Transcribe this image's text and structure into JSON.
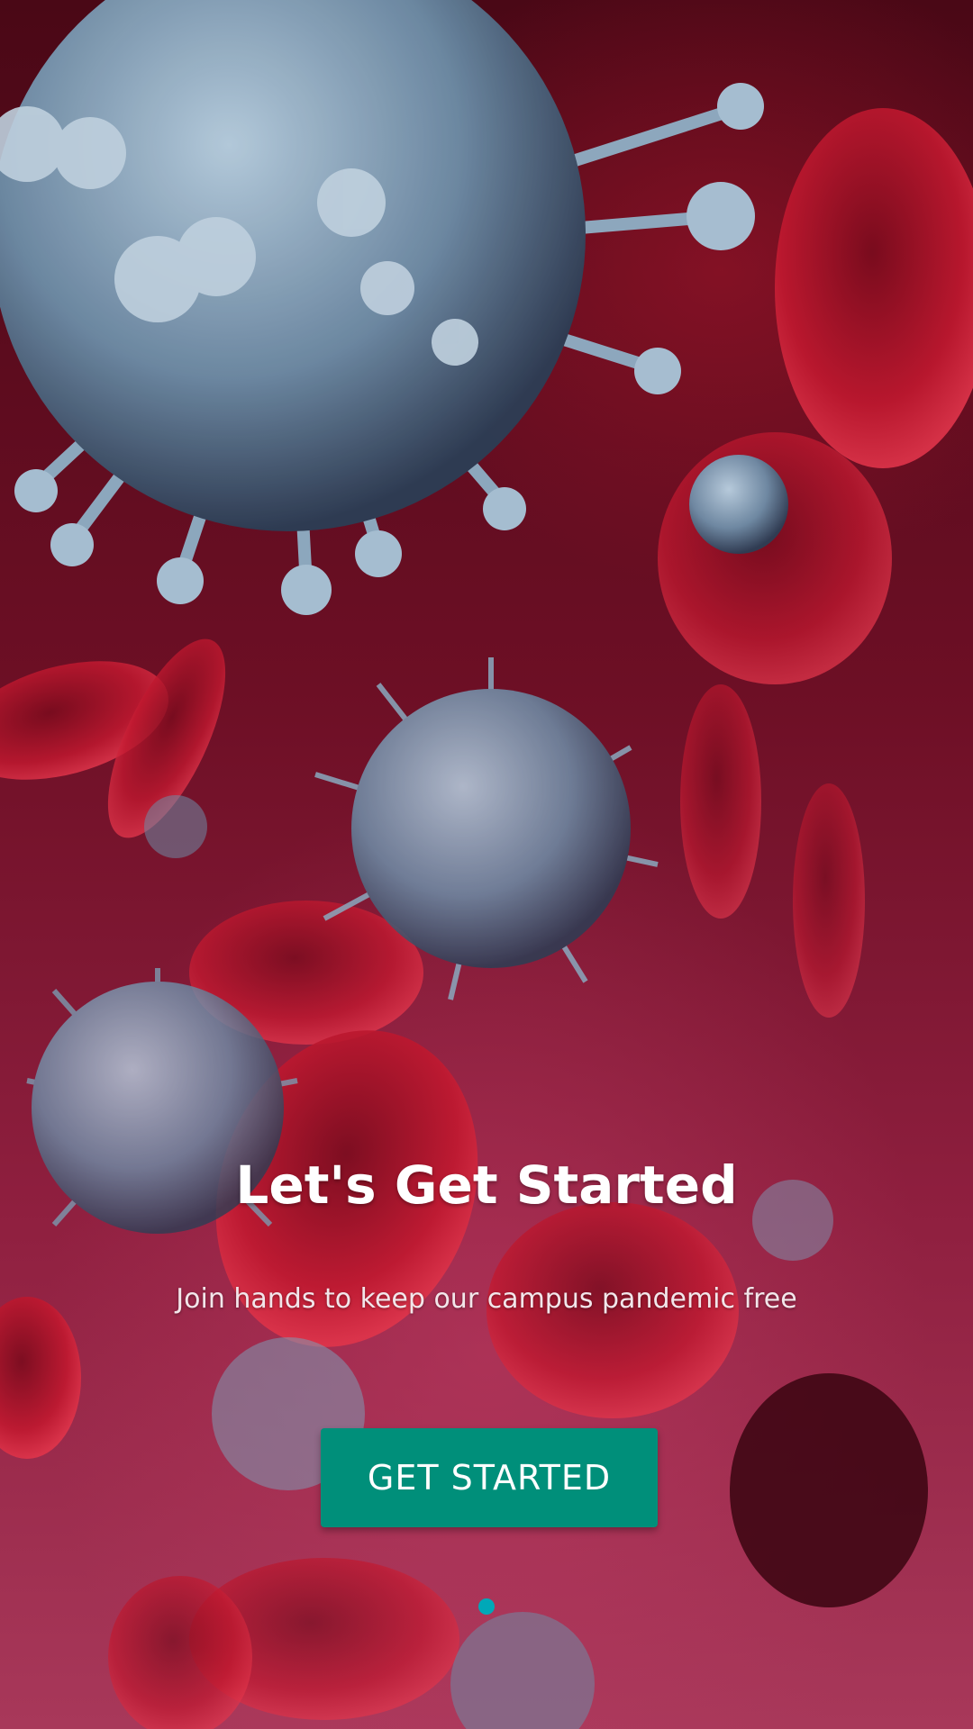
{
  "onboarding": {
    "title": "Let's Get Started",
    "subtitle": "Join hands to keep our campus pandemic free",
    "cta_label": "GET STARTED",
    "page_indicator": {
      "count": 1,
      "active_index": 0
    }
  },
  "colors": {
    "accent": "#008f7a",
    "indicator": "#00a8b8",
    "background": "#6d0f25"
  },
  "background_image": "virus-and-blood-cells-illustration"
}
